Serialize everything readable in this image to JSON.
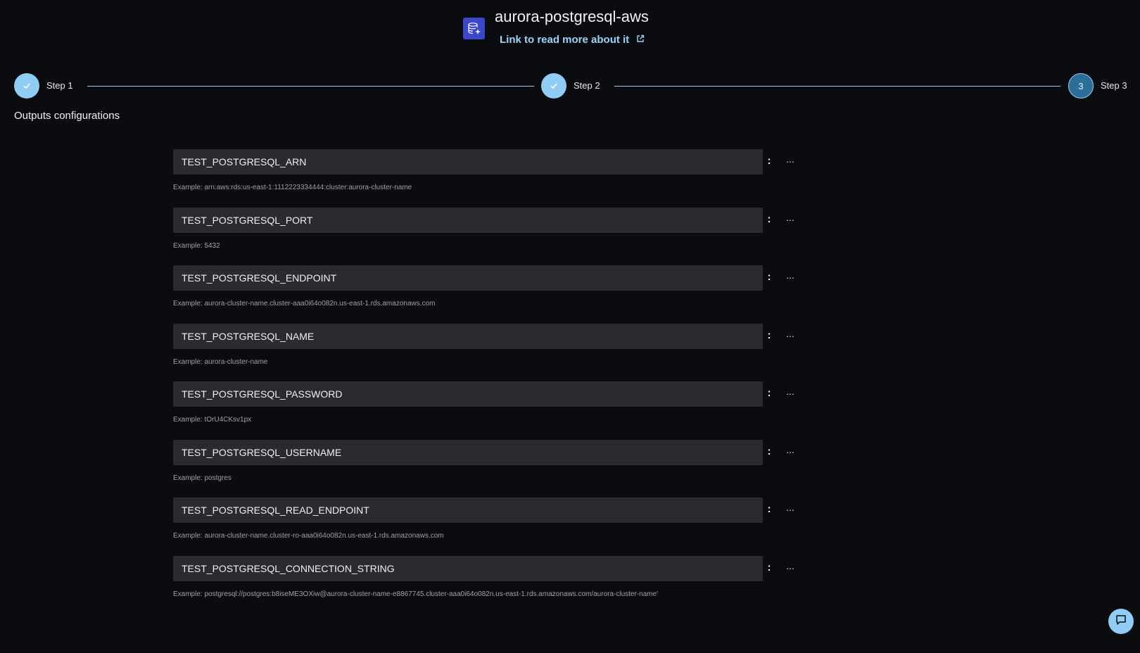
{
  "header": {
    "icon": "database-sparkle-icon",
    "title": "aurora-postgresql-aws",
    "link_label": "Link to read more about it",
    "accent": "#3b46c9",
    "link_color": "#9bd4f5"
  },
  "stepper": {
    "steps": [
      {
        "label": "Step 1",
        "state": "done"
      },
      {
        "label": "Step 2",
        "state": "done"
      },
      {
        "label": "Step 3",
        "state": "active",
        "number": "3"
      }
    ],
    "line_color": "#90cdf4"
  },
  "section": {
    "title": "Outputs configurations"
  },
  "outputs": [
    {
      "key": "TEST_POSTGRESQL_ARN",
      "separator": ":",
      "value": "...",
      "example": "Example: arn:aws:rds:us-east-1:1112223334444:cluster:aurora-cluster-name"
    },
    {
      "key": "TEST_POSTGRESQL_PORT",
      "separator": ":",
      "value": "...",
      "example": "Example: 5432"
    },
    {
      "key": "TEST_POSTGRESQL_ENDPOINT",
      "separator": ":",
      "value": "...",
      "example": "Example: aurora-cluster-name.cluster-aaa0i64o082n.us-east-1.rds.amazonaws.com"
    },
    {
      "key": "TEST_POSTGRESQL_NAME",
      "separator": ":",
      "value": "...",
      "example": "Example: aurora-cluster-name"
    },
    {
      "key": "TEST_POSTGRESQL_PASSWORD",
      "separator": ":",
      "value": "...",
      "example": "Example: tOrU4CKsv1px"
    },
    {
      "key": "TEST_POSTGRESQL_USERNAME",
      "separator": ":",
      "value": "...",
      "example": "Example: postgres"
    },
    {
      "key": "TEST_POSTGRESQL_READ_ENDPOINT",
      "separator": ":",
      "value": "...",
      "example": "Example: aurora-cluster-name.cluster-ro-aaa0i64o082n.us-east-1.rds.amazonaws.com"
    },
    {
      "key": "TEST_POSTGRESQL_CONNECTION_STRING",
      "separator": ":",
      "value": "...",
      "example": "Example: postgresql://postgres:b8iseME3OXiw@aurora-cluster-name-e8867745.cluster-aaa0i64o082n.us-east-1.rds.amazonaws.com/aurora-cluster-name'"
    }
  ],
  "chat": {
    "icon": "chat-bubble-icon"
  }
}
